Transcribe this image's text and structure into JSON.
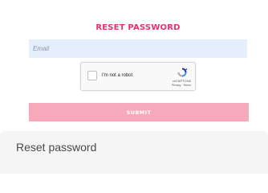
{
  "form": {
    "title": "RESET PASSWORD",
    "email_placeholder": "Email",
    "submit_label": "SUBMIT"
  },
  "recaptcha": {
    "label": "I'm not a robot",
    "brand": "reCAPTCHA",
    "privacy_label": "Privacy",
    "separator": " - ",
    "terms_label": "Terms",
    "logo_icon": "recaptcha-logo-icon"
  },
  "footer": {
    "caption": "Reset password"
  },
  "colors": {
    "title": "#ee2e6b",
    "input_bg": "#e5eefb",
    "submit_bg": "#f7a9bc",
    "footer_bg": "#f5f5f5"
  }
}
